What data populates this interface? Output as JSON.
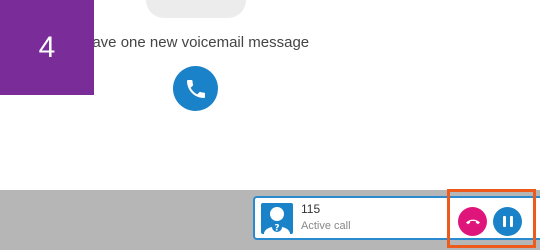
{
  "step": {
    "number": "4"
  },
  "voicemail": {
    "message": "have one new voicemail message",
    "call_icon": "phone-icon"
  },
  "active_call": {
    "number": "115",
    "status": "Active call",
    "avatar_icon": "unknown-caller-avatar-icon"
  },
  "call_controls": {
    "hangup_icon": "hang-up-icon",
    "hold_icon": "pause-icon"
  },
  "colors": {
    "step_badge": "#7a2d99",
    "accent_blue": "#1a82c8",
    "hangup_pink": "#e0157b",
    "highlight_orange": "#ee5a1c",
    "bottom_bar": "#b6b6b6"
  }
}
